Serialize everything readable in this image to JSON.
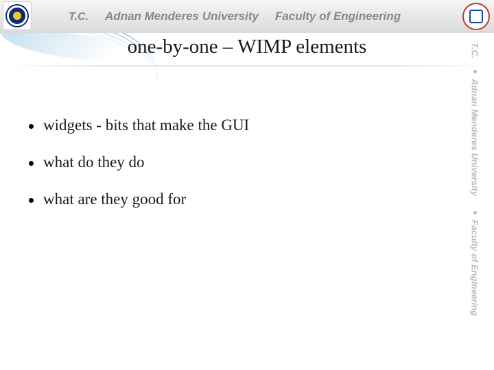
{
  "header": {
    "tc": "T.C.",
    "university": "Adnan Menderes University",
    "faculty": "Faculty of Engineering"
  },
  "slide": {
    "title": "one-by-one – WIMP elements",
    "bullets": [
      "widgets - bits that make the GUI",
      "what do they do",
      "what are they good for"
    ]
  },
  "side_watermark": {
    "tc": "T.C.",
    "university": "Adnan Menderes University",
    "faculty": "Faculty of Engineering"
  }
}
